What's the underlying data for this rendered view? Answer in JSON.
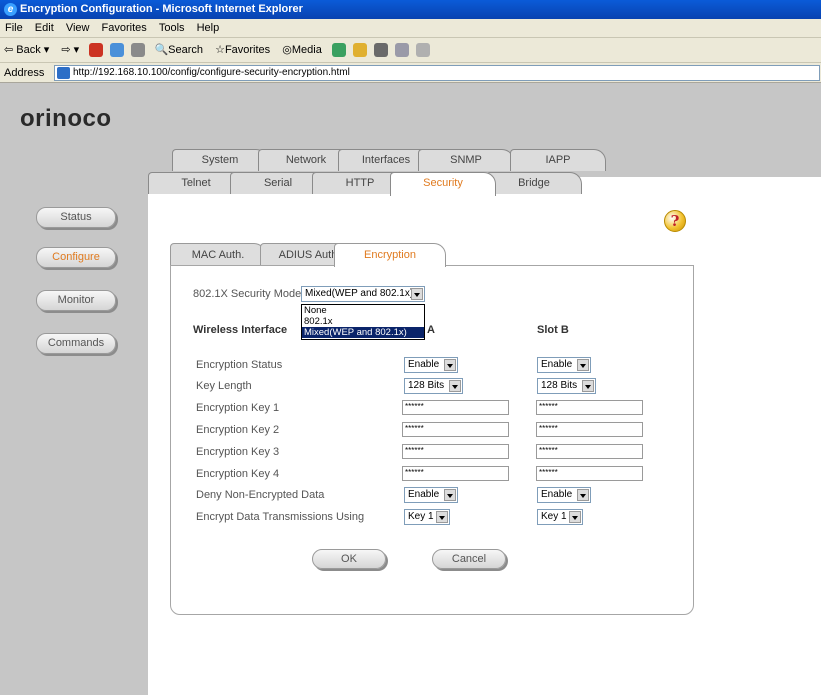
{
  "window": {
    "title": "Encryption Configuration - Microsoft Internet Explorer"
  },
  "menu": [
    "File",
    "Edit",
    "View",
    "Favorites",
    "Tools",
    "Help"
  ],
  "toolbar": {
    "back": "Back",
    "search": "Search",
    "favorites": "Favorites",
    "media": "Media"
  },
  "address": {
    "label": "Address",
    "url": "http://192.168.10.100/config/configure-security-encryption.html"
  },
  "brand": {
    "logo": "orinoco"
  },
  "tabs_row1": [
    "System",
    "Network",
    "Interfaces",
    "SNMP",
    "IAPP"
  ],
  "tabs_row2": [
    "Telnet",
    "Serial",
    "HTTP",
    "Security",
    "Bridge"
  ],
  "active_tab": "Security",
  "sidebar": [
    "Status",
    "Configure",
    "Monitor",
    "Commands"
  ],
  "active_sidebar": "Configure",
  "subtabs": [
    "MAC Auth.",
    "ADIUS Auth",
    "Encryption"
  ],
  "active_subtab": "Encryption",
  "form": {
    "security_mode_label": "802.1X Security Mode",
    "security_mode_value": "Mixed(WEP and 802.1x)",
    "security_mode_options": [
      "None",
      "802.1x",
      "Mixed(WEP and 802.1x)"
    ],
    "wireless_interface_label": "Wireless Interface",
    "slot_a_label": "A",
    "slot_b_label": "Slot B",
    "rows": [
      {
        "label": "Encryption Status",
        "a": "Enable",
        "b": "Enable"
      },
      {
        "label": "Key Length",
        "a": "128 Bits",
        "b": "128 Bits"
      },
      {
        "label": "Encryption Key 1",
        "a": "******",
        "b": "******"
      },
      {
        "label": "Encryption Key 2",
        "a": "******",
        "b": "******"
      },
      {
        "label": "Encryption Key 3",
        "a": "******",
        "b": "******"
      },
      {
        "label": "Encryption Key 4",
        "a": "******",
        "b": "******"
      },
      {
        "label": "Deny Non-Encrypted Data",
        "a": "Enable",
        "b": "Enable"
      },
      {
        "label": "Encrypt Data Transmissions Using",
        "a": "Key 1",
        "b": "Key 1"
      }
    ],
    "ok_label": "OK",
    "cancel_label": "Cancel"
  },
  "help": "?",
  "colors": {
    "accent": "#e07b20",
    "chrome": "#ece9d8",
    "title_bar": "#0a5bd8",
    "side_gray": "#c6c6c6"
  }
}
